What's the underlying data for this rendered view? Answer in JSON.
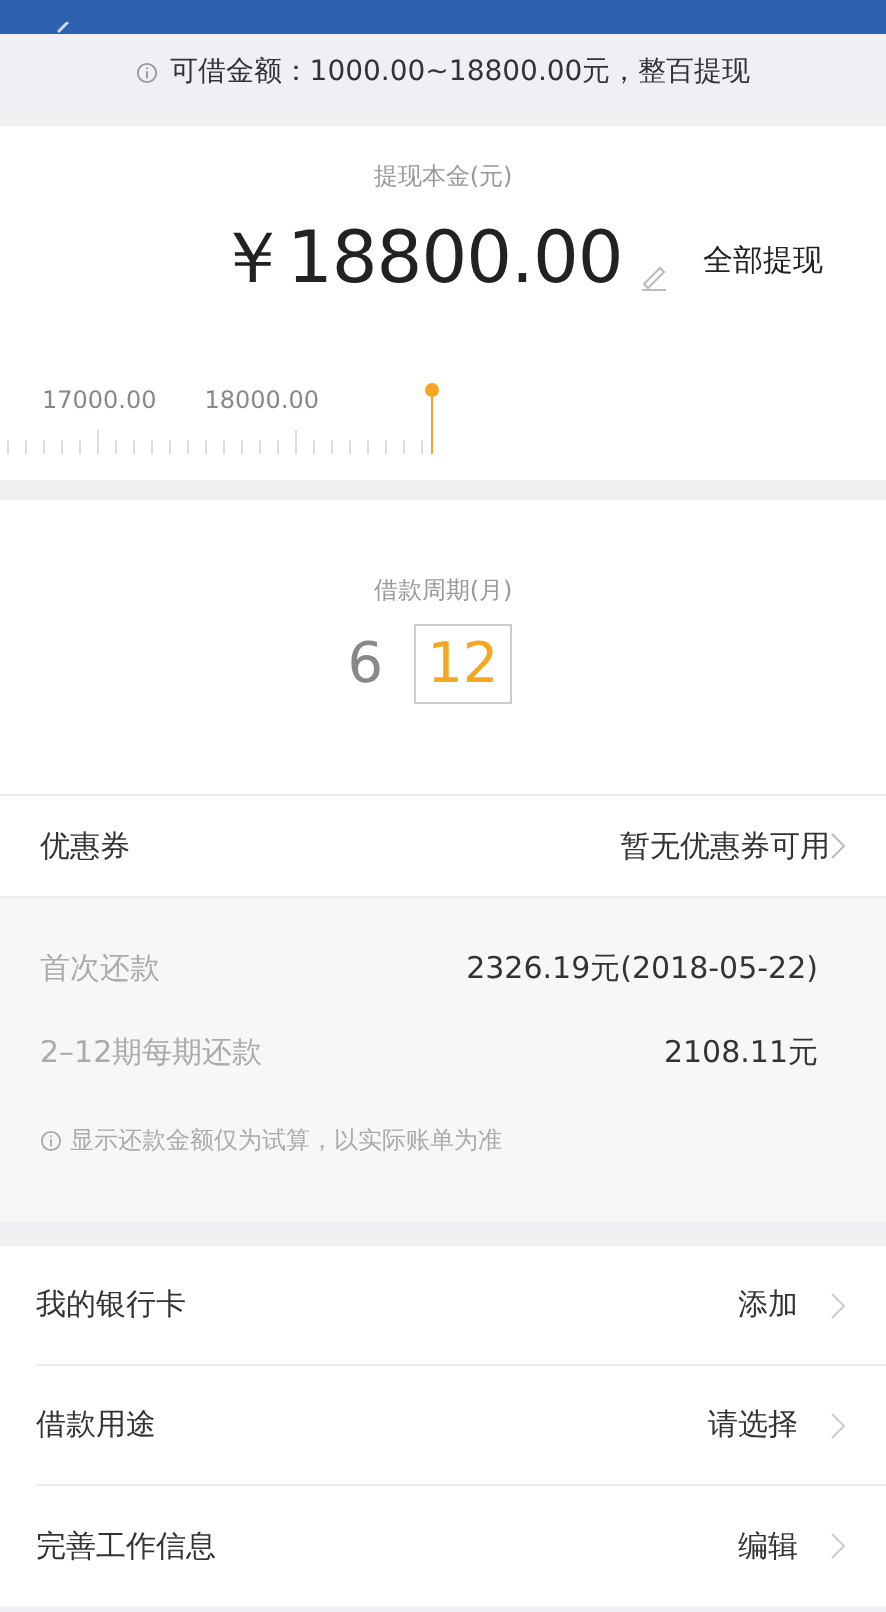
{
  "notice": {
    "text": "可借金额：1000.00~18800.00元，整百提现"
  },
  "amount": {
    "label": "提现本金(元)",
    "value": "￥18800.00",
    "all_button": "全部提现"
  },
  "ruler": {
    "labels": [
      "17000.00",
      "18000.00"
    ]
  },
  "period": {
    "label": "借款周期(月)",
    "options": [
      {
        "label": "6",
        "selected": false
      },
      {
        "label": "12",
        "selected": true
      }
    ]
  },
  "coupon": {
    "label": "优惠券",
    "value": "暂无优惠券可用"
  },
  "repayment": [
    {
      "label": "首次还款",
      "value": "2326.19元(2018-05-22)"
    },
    {
      "label": "2–12期每期还款",
      "value": "2108.11元"
    }
  ],
  "repayment_note": "显示还款金额仅为试算，以实际账单为准",
  "settings": [
    {
      "label": "我的银行卡",
      "value": "添加"
    },
    {
      "label": "借款用途",
      "value": "请选择"
    },
    {
      "label": "完善工作信息",
      "value": "编辑"
    }
  ]
}
